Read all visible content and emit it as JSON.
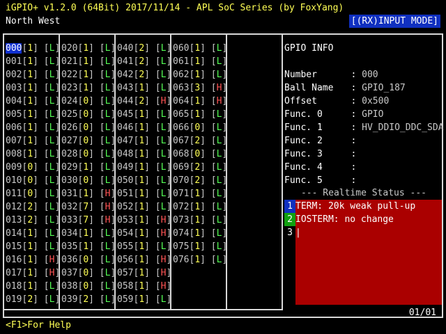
{
  "header": {
    "title": "iGPIO+ v1.2.0 (64Bit) 2017/11/14 - APL SoC Series (by FoxYang)",
    "region": "North West",
    "mode": "[(RX)INPUT MODE]"
  },
  "columns": [
    [
      {
        "num": "000",
        "val": "1",
        "lvl": "L",
        "sel": true
      },
      {
        "num": "001",
        "val": "1",
        "lvl": "L"
      },
      {
        "num": "002",
        "val": "1",
        "lvl": "L"
      },
      {
        "num": "003",
        "val": "1",
        "lvl": "L"
      },
      {
        "num": "004",
        "val": "1",
        "lvl": "L"
      },
      {
        "num": "005",
        "val": "1",
        "lvl": "L"
      },
      {
        "num": "006",
        "val": "1",
        "lvl": "L"
      },
      {
        "num": "007",
        "val": "1",
        "lvl": "L"
      },
      {
        "num": "008",
        "val": "1",
        "lvl": "L"
      },
      {
        "num": "009",
        "val": "0",
        "lvl": "L"
      },
      {
        "num": "010",
        "val": "0",
        "lvl": "L"
      },
      {
        "num": "011",
        "val": "0",
        "lvl": "L"
      },
      {
        "num": "012",
        "val": "2",
        "lvl": "L"
      },
      {
        "num": "013",
        "val": "2",
        "lvl": "L"
      },
      {
        "num": "014",
        "val": "1",
        "lvl": "L"
      },
      {
        "num": "015",
        "val": "1",
        "lvl": "L"
      },
      {
        "num": "016",
        "val": "1",
        "lvl": "H"
      },
      {
        "num": "017",
        "val": "1",
        "lvl": "H"
      },
      {
        "num": "018",
        "val": "1",
        "lvl": "L"
      },
      {
        "num": "019",
        "val": "2",
        "lvl": "L"
      }
    ],
    [
      {
        "num": "020",
        "val": "1",
        "lvl": "L"
      },
      {
        "num": "021",
        "val": "1",
        "lvl": "L"
      },
      {
        "num": "022",
        "val": "1",
        "lvl": "L"
      },
      {
        "num": "023",
        "val": "1",
        "lvl": "L"
      },
      {
        "num": "024",
        "val": "0",
        "lvl": "L"
      },
      {
        "num": "025",
        "val": "0",
        "lvl": "L"
      },
      {
        "num": "026",
        "val": "0",
        "lvl": "L"
      },
      {
        "num": "027",
        "val": "0",
        "lvl": "L"
      },
      {
        "num": "028",
        "val": "0",
        "lvl": "L"
      },
      {
        "num": "029",
        "val": "1",
        "lvl": "L"
      },
      {
        "num": "030",
        "val": "0",
        "lvl": "L"
      },
      {
        "num": "031",
        "val": "1",
        "lvl": "H"
      },
      {
        "num": "032",
        "val": "7",
        "lvl": "H"
      },
      {
        "num": "033",
        "val": "7",
        "lvl": "H"
      },
      {
        "num": "034",
        "val": "1",
        "lvl": "L"
      },
      {
        "num": "035",
        "val": "1",
        "lvl": "L"
      },
      {
        "num": "036",
        "val": "0",
        "lvl": "L"
      },
      {
        "num": "037",
        "val": "0",
        "lvl": "L"
      },
      {
        "num": "038",
        "val": "0",
        "lvl": "L"
      },
      {
        "num": "039",
        "val": "2",
        "lvl": "L"
      }
    ],
    [
      {
        "num": "040",
        "val": "2",
        "lvl": "L"
      },
      {
        "num": "041",
        "val": "2",
        "lvl": "L"
      },
      {
        "num": "042",
        "val": "2",
        "lvl": "L"
      },
      {
        "num": "043",
        "val": "1",
        "lvl": "L"
      },
      {
        "num": "044",
        "val": "2",
        "lvl": "H"
      },
      {
        "num": "045",
        "val": "1",
        "lvl": "L"
      },
      {
        "num": "046",
        "val": "1",
        "lvl": "L"
      },
      {
        "num": "047",
        "val": "1",
        "lvl": "L"
      },
      {
        "num": "048",
        "val": "1",
        "lvl": "L"
      },
      {
        "num": "049",
        "val": "1",
        "lvl": "L"
      },
      {
        "num": "050",
        "val": "1",
        "lvl": "L"
      },
      {
        "num": "051",
        "val": "1",
        "lvl": "L"
      },
      {
        "num": "052",
        "val": "1",
        "lvl": "L"
      },
      {
        "num": "053",
        "val": "1",
        "lvl": "H"
      },
      {
        "num": "054",
        "val": "1",
        "lvl": "H"
      },
      {
        "num": "055",
        "val": "1",
        "lvl": "L"
      },
      {
        "num": "056",
        "val": "1",
        "lvl": "H"
      },
      {
        "num": "057",
        "val": "1",
        "lvl": "H"
      },
      {
        "num": "058",
        "val": "1",
        "lvl": "H"
      },
      {
        "num": "059",
        "val": "1",
        "lvl": "L"
      }
    ],
    [
      {
        "num": "060",
        "val": "1",
        "lvl": "L"
      },
      {
        "num": "061",
        "val": "1",
        "lvl": "L"
      },
      {
        "num": "062",
        "val": "1",
        "lvl": "L"
      },
      {
        "num": "063",
        "val": "3",
        "lvl": "H"
      },
      {
        "num": "064",
        "val": "1",
        "lvl": "H"
      },
      {
        "num": "065",
        "val": "1",
        "lvl": "L"
      },
      {
        "num": "066",
        "val": "0",
        "lvl": "L"
      },
      {
        "num": "067",
        "val": "2",
        "lvl": "L"
      },
      {
        "num": "068",
        "val": "0",
        "lvl": "L"
      },
      {
        "num": "069",
        "val": "2",
        "lvl": "L"
      },
      {
        "num": "070",
        "val": "2",
        "lvl": "L"
      },
      {
        "num": "071",
        "val": "1",
        "lvl": "L"
      },
      {
        "num": "072",
        "val": "1",
        "lvl": "L"
      },
      {
        "num": "073",
        "val": "1",
        "lvl": "L"
      },
      {
        "num": "074",
        "val": "1",
        "lvl": "L"
      },
      {
        "num": "075",
        "val": "1",
        "lvl": "L"
      },
      {
        "num": "076",
        "val": "1",
        "lvl": "L"
      }
    ]
  ],
  "info": {
    "title": "GPIO INFO",
    "fields": [
      {
        "label": "Number",
        "value": "000"
      },
      {
        "label": "Ball Name",
        "value": "GPIO_187"
      },
      {
        "label": "Offset",
        "value": "0x500"
      },
      {
        "label": "Func. 0",
        "value": "GPIO"
      },
      {
        "label": "Func. 1",
        "value": "HV_DDIO_DDC_SDA"
      },
      {
        "label": "Func. 2",
        "value": ""
      },
      {
        "label": "Func. 3",
        "value": ""
      },
      {
        "label": "Func. 4",
        "value": ""
      },
      {
        "label": "Func. 5",
        "value": ""
      }
    ],
    "realtime_title": "--- Realtime Status ---",
    "status": [
      {
        "tag": "1",
        "text": "TERM: 20k weak pull-up"
      },
      {
        "tag": "2",
        "text": "IOSTERM: no change"
      },
      {
        "tag": "3",
        "text": "|"
      }
    ]
  },
  "page": "01/01",
  "footer": "<F1>For Help",
  "colors": {
    "background": "#000000",
    "accent": "#1030c0",
    "status_box": "#aa0000",
    "value": "#ffff55",
    "low": "#55ff55",
    "high": "#ff5555"
  }
}
